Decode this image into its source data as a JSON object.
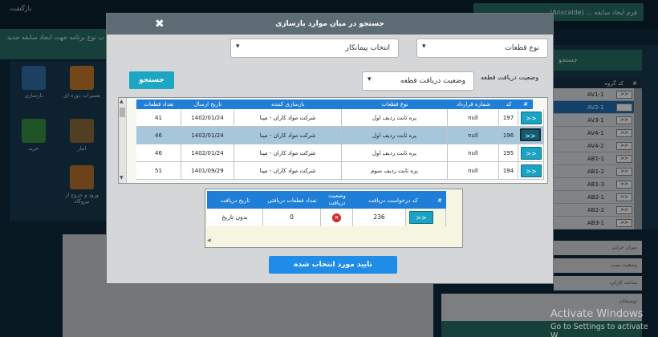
{
  "background": {
    "back_label": "بازگشت",
    "form_title": "فرم ایجاد سابقه ... (Anscalde)",
    "left_band": "ب نوع برنامه جهت ایجاد سابقه جدید",
    "tiles": [
      {
        "label": "بازسازی"
      },
      {
        "label": "تعمیرات دوره ای"
      },
      {
        "label": "خرید"
      },
      {
        "label": "انبار"
      },
      {
        "label": "ورود و خروج از نیروگاه"
      }
    ],
    "right_button": "جستجو",
    "right_table": {
      "header_code": "کد گروه",
      "header_num": "#",
      "rows": [
        {
          "code": "AV1-1",
          "btn": ">>"
        },
        {
          "code": "AV2-1",
          "btn": ">>"
        },
        {
          "code": "AV3-1",
          "btn": ">>"
        },
        {
          "code": "AV4-1",
          "btn": ">>"
        },
        {
          "code": "AV4-2",
          "btn": ">>"
        },
        {
          "code": "AB1-1",
          "btn": ">>"
        },
        {
          "code": "AB1-2",
          "btn": ">>"
        },
        {
          "code": "AB1-3",
          "btn": ">>"
        },
        {
          "code": "AB2-1",
          "btn": ">>"
        },
        {
          "code": "AB2-2",
          "btn": ">>"
        },
        {
          "code": "AB3-1",
          "btn": ">>"
        },
        {
          "code": "AB4-1",
          "btn": ">>"
        }
      ]
    },
    "right_fields": [
      "میزان خرابی",
      "وضعیت نصب",
      "ساعت کارکرد"
    ],
    "notes_label": "توضیحات"
  },
  "watermark": {
    "line1": "Activate Windows",
    "line2": "Go to Settings to activate W"
  },
  "modal": {
    "title": "جستجو در میان موارد بازسازی",
    "close_glyph": "✖",
    "filters": {
      "part_type": "نوع قطعات",
      "contractor": "انتخاب پیمانکار",
      "receive_status_label": "وضعیت دریافت قطعه",
      "receive_status": "وضعیت دریافت قطعه"
    },
    "search_button": "جستجو",
    "parts_table": {
      "headers": [
        "#",
        "کد",
        "شماره قرارداد",
        "نوع قطعات",
        "بازسازی کننده",
        "تاریخ ارسال",
        "تعداد قطعات"
      ],
      "select_label": ">>",
      "rows": [
        {
          "code": "197",
          "contract": "null",
          "part": "پره ثابت ردیف اول",
          "maker": "شرکت مواد کاران - مپنا",
          "date": "1402/01/24",
          "count": "41",
          "selected": false
        },
        {
          "code": "196",
          "contract": "null",
          "part": "پره ثابت ردیف اول",
          "maker": "شرکت مواد کاران - مپنا",
          "date": "1402/01/24",
          "count": "46",
          "selected": true
        },
        {
          "code": "195",
          "contract": "null",
          "part": "پره ثابت ردیف اول",
          "maker": "شرکت مواد کاران - مپنا",
          "date": "1402/01/24",
          "count": "46",
          "selected": false
        },
        {
          "code": "194",
          "contract": "null",
          "part": "پره ثابت ردیف سوم",
          "maker": "شرکت مواد کاران - مپنا",
          "date": "1401/09/29",
          "count": "51",
          "selected": false
        }
      ]
    },
    "receive_table": {
      "headers": [
        "#",
        "کد درخواست دریافت",
        "وضعیت دریافت",
        "تعداد قطعات دریافتی",
        "تاریخ دریافت"
      ],
      "row": {
        "btn": ">>",
        "request_code": "236",
        "status_icon": "error-x-icon",
        "received_count": "0",
        "receive_date": "بدون تاریخ"
      }
    },
    "confirm_button": "تایید مورد انتخاب شده"
  },
  "colors": {
    "header_blue": "#1f7ed8",
    "teal_button": "#1aa3c4",
    "selected_row": "#a6c6dc",
    "confirm_blue": "#1f8de8"
  }
}
